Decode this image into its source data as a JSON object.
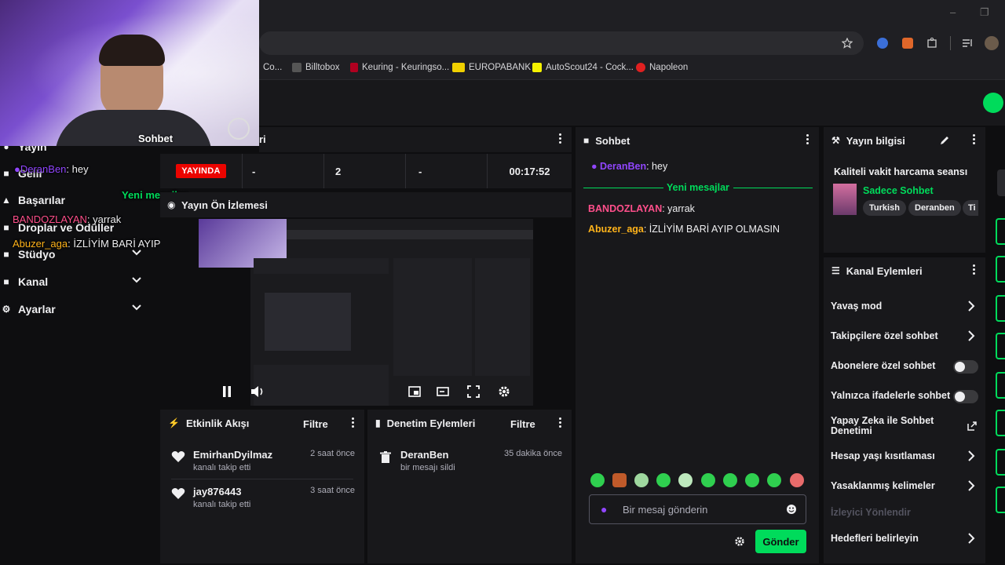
{
  "browser": {
    "bookmarks": [
      {
        "label": "Co...",
        "color": "#d93025"
      },
      {
        "label": "Billtobox",
        "color": "#444"
      },
      {
        "label": "Keuring - Keuringso...",
        "color": "#b00020"
      },
      {
        "label": "EUROPABANK",
        "color": "#f0d000"
      },
      {
        "label": "AutoScout24 - Cock...",
        "color": "#f5f200"
      },
      {
        "label": "Napoleon",
        "color": "#e02020"
      }
    ]
  },
  "webcam": {
    "label": "Sohbet"
  },
  "sidebar": {
    "items": [
      {
        "label": "Yayın"
      },
      {
        "label": "Gelir"
      },
      {
        "label": "Başarılar"
      },
      {
        "label": "Droplar ve Ödüller"
      },
      {
        "label": "Stüdyo"
      },
      {
        "label": "Kanal"
      },
      {
        "label": "Ayarlar"
      }
    ]
  },
  "overlay_chat": {
    "line1_user": "DeranBen",
    "line1_text": ": hey",
    "new_messages": "Yeni mesajlar",
    "line2_user": "BANDOZLAYAN",
    "line2_text": ": yarrak",
    "line3_user": "Abuzer_aga",
    "line3_text": ": İZLİYİM BARİ AYIP OLMASIN"
  },
  "stats": {
    "title_fragment": "ri",
    "live": "YAYINDA",
    "viewers": "-",
    "followers": "2",
    "subs": "-",
    "uptime": "00:17:52"
  },
  "preview": {
    "title": "Yayın Ön İzlemesi"
  },
  "activity": {
    "title": "Etkinlik Akışı",
    "filter": "Filtre",
    "items": [
      {
        "name": "EmirhanDyilmaz",
        "sub": "kanalı takip etti",
        "time": "2 saat önce"
      },
      {
        "name": "jay876443",
        "sub": "kanalı takip etti",
        "time": "3 saat önce"
      }
    ]
  },
  "moderation": {
    "title": "Denetim Eylemleri",
    "filter": "Filtre",
    "items": [
      {
        "name": "DeranBen",
        "sub": "bir mesajı sildi",
        "time": "35 dakika önce"
      }
    ]
  },
  "chat": {
    "title": "Sohbet",
    "messages": [
      {
        "user": "DeranBen",
        "text": ": hey",
        "color": "#9146ff"
      },
      {
        "user": "BANDOZLAYAN",
        "text": ": yarrak",
        "color": "#ff4f8b"
      },
      {
        "user": "Abuzer_aga",
        "text": ": İZLİYİM BARİ AYIP OLMASIN",
        "color": "#ffb31a"
      }
    ],
    "new_messages": "Yeni mesajlar",
    "input_placeholder": "Bir mesaj gönderin",
    "send": "Gönder"
  },
  "stream_info": {
    "title": "Yayın bilgisi",
    "stream_title": "Kaliteli vakit harcama seansı",
    "category": "Sadece Sohbet",
    "tags": [
      "Turkish",
      "Deranben",
      "Ti"
    ]
  },
  "channel_actions": {
    "title": "Kanal Eylemleri",
    "items": [
      {
        "label": "Yavaş mod"
      },
      {
        "label": "Takipçilere özel sohbet"
      },
      {
        "label": "Abonelere özel sohbet"
      },
      {
        "label": "Yalnızca ifadelerle sohbet"
      },
      {
        "label": "Yapay Zeka ile Sohbet Denetimi"
      },
      {
        "label": "Hesap yaşı kısıtlaması"
      },
      {
        "label": "Yasaklanmış kelimeler"
      },
      {
        "label": "İzleyici Yönlendir"
      },
      {
        "label": "Hedefleri belirleyin"
      }
    ]
  },
  "colors": {
    "accent": "#00db5b",
    "live": "#eb0400",
    "panel": "#18181b",
    "bg": "#0e0e10"
  }
}
